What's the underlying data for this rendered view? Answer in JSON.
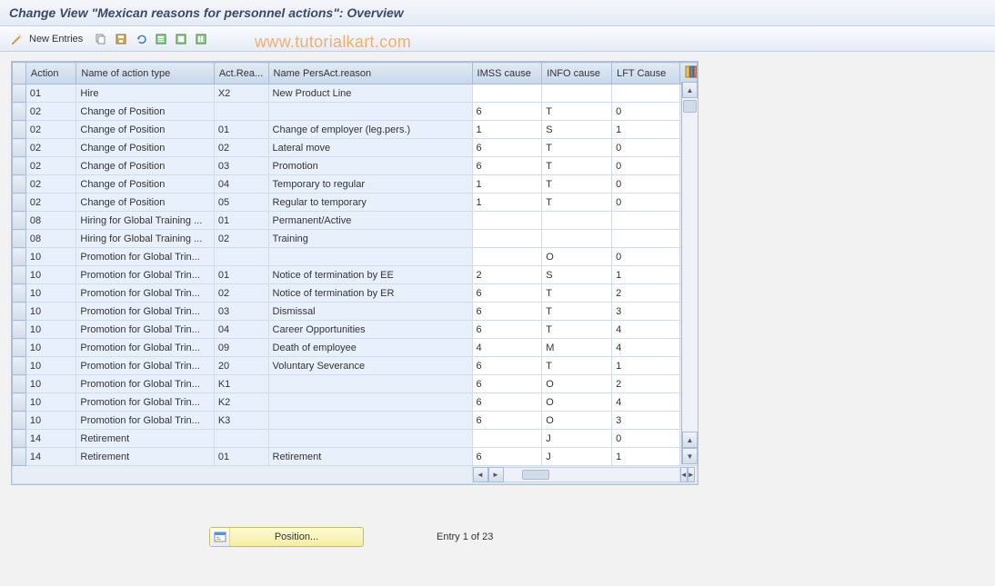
{
  "title": "Change View \"Mexican reasons for personnel actions\": Overview",
  "toolbar": {
    "new_entries": "New Entries"
  },
  "watermark": "www.tutorialkart.com",
  "columns": {
    "action": "Action",
    "name_action_type": "Name of action type",
    "act_rea": "Act.Rea...",
    "name_persact": "Name PersAct.reason",
    "imss": "IMSS cause",
    "info": "INFO cause",
    "lft": "LFT Cause"
  },
  "rows": [
    {
      "action": "01",
      "name": "Hire",
      "actrea": "X2",
      "persact": "New Product Line",
      "imss": "",
      "info": "",
      "lft": ""
    },
    {
      "action": "02",
      "name": "Change of Position",
      "actrea": "",
      "persact": "",
      "imss": "6",
      "info": "T",
      "lft": "0"
    },
    {
      "action": "02",
      "name": "Change of Position",
      "actrea": "01",
      "persact": "Change of employer (leg.pers.)",
      "imss": "1",
      "info": "S",
      "lft": "1"
    },
    {
      "action": "02",
      "name": "Change of Position",
      "actrea": "02",
      "persact": "Lateral move",
      "imss": "6",
      "info": "T",
      "lft": "0"
    },
    {
      "action": "02",
      "name": "Change of Position",
      "actrea": "03",
      "persact": "Promotion",
      "imss": "6",
      "info": "T",
      "lft": "0"
    },
    {
      "action": "02",
      "name": "Change of Position",
      "actrea": "04",
      "persact": "Temporary to regular",
      "imss": "1",
      "info": "T",
      "lft": "0"
    },
    {
      "action": "02",
      "name": "Change of Position",
      "actrea": "05",
      "persact": "Regular to temporary",
      "imss": "1",
      "info": "T",
      "lft": "0"
    },
    {
      "action": "08",
      "name": "Hiring for Global Training ...",
      "actrea": "01",
      "persact": "Permanent/Active",
      "imss": "",
      "info": "",
      "lft": ""
    },
    {
      "action": "08",
      "name": "Hiring for Global Training ...",
      "actrea": "02",
      "persact": "Training",
      "imss": "",
      "info": "",
      "lft": ""
    },
    {
      "action": "10",
      "name": "Promotion for Global Trin...",
      "actrea": "",
      "persact": "",
      "imss": "",
      "info": "O",
      "lft": "0"
    },
    {
      "action": "10",
      "name": "Promotion for Global Trin...",
      "actrea": "01",
      "persact": "Notice of termination by EE",
      "imss": "2",
      "info": "S",
      "lft": "1"
    },
    {
      "action": "10",
      "name": "Promotion for Global Trin...",
      "actrea": "02",
      "persact": "Notice of termination by ER",
      "imss": "6",
      "info": "T",
      "lft": "2"
    },
    {
      "action": "10",
      "name": "Promotion for Global Trin...",
      "actrea": "03",
      "persact": "Dismissal",
      "imss": "6",
      "info": "T",
      "lft": "3"
    },
    {
      "action": "10",
      "name": "Promotion for Global Trin...",
      "actrea": "04",
      "persact": "Career Opportunities",
      "imss": "6",
      "info": "T",
      "lft": "4"
    },
    {
      "action": "10",
      "name": "Promotion for Global Trin...",
      "actrea": "09",
      "persact": "Death of employee",
      "imss": "4",
      "info": "M",
      "lft": "4"
    },
    {
      "action": "10",
      "name": "Promotion for Global Trin...",
      "actrea": "20",
      "persact": "Voluntary Severance",
      "imss": "6",
      "info": "T",
      "lft": "1"
    },
    {
      "action": "10",
      "name": "Promotion for Global Trin...",
      "actrea": "K1",
      "persact": "",
      "imss": "6",
      "info": "O",
      "lft": "2"
    },
    {
      "action": "10",
      "name": "Promotion for Global Trin...",
      "actrea": "K2",
      "persact": "",
      "imss": "6",
      "info": "O",
      "lft": "4"
    },
    {
      "action": "10",
      "name": "Promotion for Global Trin...",
      "actrea": "K3",
      "persact": "",
      "imss": "6",
      "info": "O",
      "lft": "3"
    },
    {
      "action": "14",
      "name": "Retirement",
      "actrea": "",
      "persact": "",
      "imss": "",
      "info": "J",
      "lft": "0"
    },
    {
      "action": "14",
      "name": "Retirement",
      "actrea": "01",
      "persact": "Retirement",
      "imss": "6",
      "info": "J",
      "lft": "1"
    }
  ],
  "footer": {
    "position_label": "Position...",
    "entry_text": "Entry 1 of 23"
  }
}
